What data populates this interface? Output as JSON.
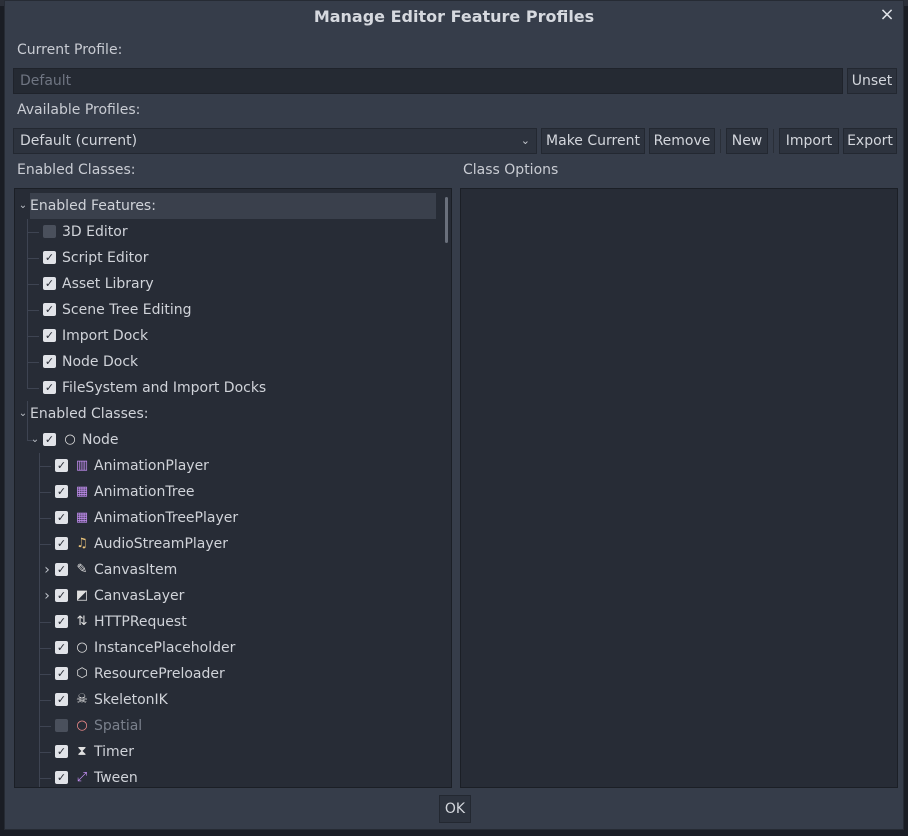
{
  "dialog": {
    "title": "Manage Editor Feature Profiles",
    "close_icon": "×"
  },
  "current_profile": {
    "label": "Current Profile:",
    "placeholder": "Default",
    "unset_label": "Unset"
  },
  "available_profiles": {
    "label": "Available Profiles:",
    "selected": "Default (current)",
    "buttons": {
      "make_current": "Make Current",
      "remove": "Remove",
      "new": "New",
      "import": "Import",
      "export": "Export"
    }
  },
  "enabled_classes_label": "Enabled Classes:",
  "class_options_label": "Class Options",
  "tree": {
    "features_header": "Enabled Features:",
    "features": [
      {
        "label": "3D Editor",
        "checked": false
      },
      {
        "label": "Script Editor",
        "checked": true
      },
      {
        "label": "Asset Library",
        "checked": true
      },
      {
        "label": "Scene Tree Editing",
        "checked": true
      },
      {
        "label": "Import Dock",
        "checked": true
      },
      {
        "label": "Node Dock",
        "checked": true
      },
      {
        "label": "FileSystem and Import Docks",
        "checked": true
      }
    ],
    "classes_header": "Enabled Classes:",
    "node": {
      "label": "Node",
      "checked": true,
      "icon": "circle-node-icon",
      "color": "#e0e0e0"
    },
    "children": [
      {
        "label": "AnimationPlayer",
        "checked": true,
        "icon": "film-icon",
        "glyph": "▥",
        "color": "#c38ef1",
        "expandable": false
      },
      {
        "label": "AnimationTree",
        "checked": true,
        "icon": "animation-tree-icon",
        "glyph": "▦",
        "color": "#c38ef1",
        "expandable": false
      },
      {
        "label": "AnimationTreePlayer",
        "checked": true,
        "icon": "animation-tree-player-icon",
        "glyph": "▦",
        "color": "#c38ef1",
        "expandable": false
      },
      {
        "label": "AudioStreamPlayer",
        "checked": true,
        "icon": "music-note-icon",
        "glyph": "♫",
        "color": "#e8c27a",
        "expandable": false
      },
      {
        "label": "CanvasItem",
        "checked": true,
        "icon": "brush-icon",
        "glyph": "✎",
        "color": "#e0e0e0",
        "expandable": true
      },
      {
        "label": "CanvasLayer",
        "checked": true,
        "icon": "canvas-layer-icon",
        "glyph": "◩",
        "color": "#e0e0e0",
        "expandable": true
      },
      {
        "label": "HTTPRequest",
        "checked": true,
        "icon": "http-request-icon",
        "glyph": "⇅",
        "color": "#e0e0e0",
        "expandable": false
      },
      {
        "label": "InstancePlaceholder",
        "checked": true,
        "icon": "circle-node-icon",
        "glyph": "○",
        "color": "#e0e0e0",
        "expandable": false
      },
      {
        "label": "ResourcePreloader",
        "checked": true,
        "icon": "cube-icon",
        "glyph": "⬡",
        "color": "#e0e0e0",
        "expandable": false
      },
      {
        "label": "SkeletonIK",
        "checked": true,
        "icon": "skull-icon",
        "glyph": "☠",
        "color": "#e0e0e0",
        "expandable": false
      },
      {
        "label": "Spatial",
        "checked": false,
        "icon": "spatial-circle-icon",
        "glyph": "○",
        "color": "#f28c8c",
        "expandable": false
      },
      {
        "label": "Timer",
        "checked": true,
        "icon": "hourglass-icon",
        "glyph": "⧗",
        "color": "#e0e0e0",
        "expandable": false
      },
      {
        "label": "Tween",
        "checked": true,
        "icon": "tween-icon",
        "glyph": "⤢",
        "color": "#c38ef1",
        "expandable": false
      }
    ]
  },
  "ok_label": "OK"
}
